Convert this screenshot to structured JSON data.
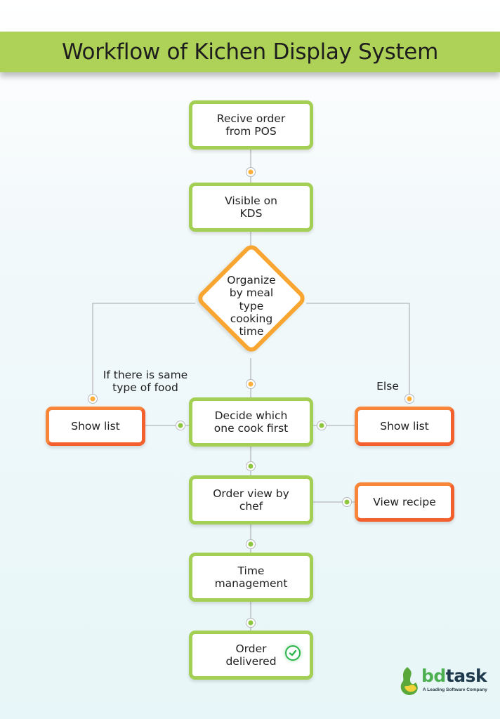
{
  "title": "Workflow of Kichen Display System",
  "colors": {
    "banner": "#aed257",
    "green_border": "#a3cf55",
    "orange_border": "#f57a33",
    "decision_border": "#f9a531",
    "connector_line": "#b5b8ba",
    "dot_orange": "#fbb03b",
    "dot_green": "#8dc63f",
    "check_green": "#2ab54a"
  },
  "nodes": {
    "receive_order": "Recive order from POS",
    "visible_kds": "Visible on KDS",
    "organize": "Organize\nby meal\ntype\ncooking\ntime",
    "decide": "Decide which one cook first",
    "show_list_left": "Show list",
    "show_list_right": "Show list",
    "order_view": "Order view by chef",
    "view_recipe": "View recipe",
    "time_management": "Time management",
    "order_delivered": "Order delivered"
  },
  "branch_labels": {
    "left": "If there is same type of food",
    "right": "Else"
  },
  "logo": {
    "brand_part1": "bd",
    "brand_part2": "task",
    "tagline": "A Leading Software Company"
  }
}
